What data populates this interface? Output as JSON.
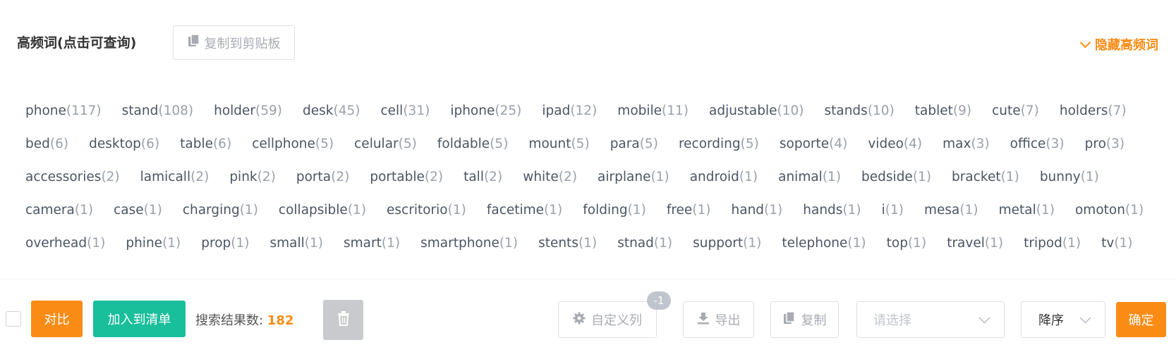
{
  "header": {
    "title": "高频词(点击可查询)",
    "copy_clipboard_label": "复制到剪贴板",
    "hide_label": "隐藏高频词"
  },
  "words": [
    [
      {
        "w": "phone",
        "c": "(117)"
      },
      {
        "w": "stand",
        "c": "(108)"
      },
      {
        "w": "holder",
        "c": "(59)"
      },
      {
        "w": "desk",
        "c": "(45)"
      },
      {
        "w": "cell",
        "c": "(31)"
      },
      {
        "w": "iphone",
        "c": "(25)"
      },
      {
        "w": "ipad",
        "c": "(12)"
      },
      {
        "w": "mobile",
        "c": "(11)"
      },
      {
        "w": "adjustable",
        "c": "(10)"
      },
      {
        "w": "stands",
        "c": "(10)"
      },
      {
        "w": "tablet",
        "c": "(9)"
      },
      {
        "w": "cute",
        "c": "(7)"
      },
      {
        "w": "holders",
        "c": "(7)"
      }
    ],
    [
      {
        "w": "bed",
        "c": "(6)"
      },
      {
        "w": "desktop",
        "c": "(6)"
      },
      {
        "w": "table",
        "c": "(6)"
      },
      {
        "w": "cellphone",
        "c": "(5)"
      },
      {
        "w": "celular",
        "c": "(5)"
      },
      {
        "w": "foldable",
        "c": "(5)"
      },
      {
        "w": "mount",
        "c": "(5)"
      },
      {
        "w": "para",
        "c": "(5)"
      },
      {
        "w": "recording",
        "c": "(5)"
      },
      {
        "w": "soporte",
        "c": "(4)"
      },
      {
        "w": "video",
        "c": "(4)"
      },
      {
        "w": "max",
        "c": "(3)"
      },
      {
        "w": "office",
        "c": "(3)"
      },
      {
        "w": "pro",
        "c": "(3)"
      }
    ],
    [
      {
        "w": "accessories",
        "c": "(2)"
      },
      {
        "w": "lamicall",
        "c": "(2)"
      },
      {
        "w": "pink",
        "c": "(2)"
      },
      {
        "w": "porta",
        "c": "(2)"
      },
      {
        "w": "portable",
        "c": "(2)"
      },
      {
        "w": "tall",
        "c": "(2)"
      },
      {
        "w": "white",
        "c": "(2)"
      },
      {
        "w": "airplane",
        "c": "(1)"
      },
      {
        "w": "android",
        "c": "(1)"
      },
      {
        "w": "animal",
        "c": "(1)"
      },
      {
        "w": "bedside",
        "c": "(1)"
      },
      {
        "w": "bracket",
        "c": "(1)"
      },
      {
        "w": "bunny",
        "c": "(1)"
      }
    ],
    [
      {
        "w": "camera",
        "c": "(1)"
      },
      {
        "w": "case",
        "c": "(1)"
      },
      {
        "w": "charging",
        "c": "(1)"
      },
      {
        "w": "collapsible",
        "c": "(1)"
      },
      {
        "w": "escritorio",
        "c": "(1)"
      },
      {
        "w": "facetime",
        "c": "(1)"
      },
      {
        "w": "folding",
        "c": "(1)"
      },
      {
        "w": "free",
        "c": "(1)"
      },
      {
        "w": "hand",
        "c": "(1)"
      },
      {
        "w": "hands",
        "c": "(1)"
      },
      {
        "w": "i",
        "c": "(1)"
      },
      {
        "w": "mesa",
        "c": "(1)"
      },
      {
        "w": "metal",
        "c": "(1)"
      },
      {
        "w": "omoton",
        "c": "(1)"
      }
    ],
    [
      {
        "w": "overhead",
        "c": "(1)"
      },
      {
        "w": "phine",
        "c": "(1)"
      },
      {
        "w": "prop",
        "c": "(1)"
      },
      {
        "w": "small",
        "c": "(1)"
      },
      {
        "w": "smart",
        "c": "(1)"
      },
      {
        "w": "smartphone",
        "c": "(1)"
      },
      {
        "w": "stents",
        "c": "(1)"
      },
      {
        "w": "stnad",
        "c": "(1)"
      },
      {
        "w": "support",
        "c": "(1)"
      },
      {
        "w": "telephone",
        "c": "(1)"
      },
      {
        "w": "top",
        "c": "(1)"
      },
      {
        "w": "travel",
        "c": "(1)"
      },
      {
        "w": "tripod",
        "c": "(1)"
      },
      {
        "w": "tv",
        "c": "(1)"
      }
    ]
  ],
  "footer": {
    "compare_label": "对比",
    "add_list_label": "加入到清单",
    "result_label": "搜索结果数: ",
    "result_count": "182",
    "custom_columns_label": "自定义列",
    "custom_columns_badge": "-1",
    "export_label": "导出",
    "copy_label": "复制",
    "select_placeholder": "请选择",
    "sort_label": "降序",
    "confirm_label": "确定"
  },
  "colors": {
    "accent_orange": "#fa8c16",
    "accent_green": "#19be9b"
  }
}
